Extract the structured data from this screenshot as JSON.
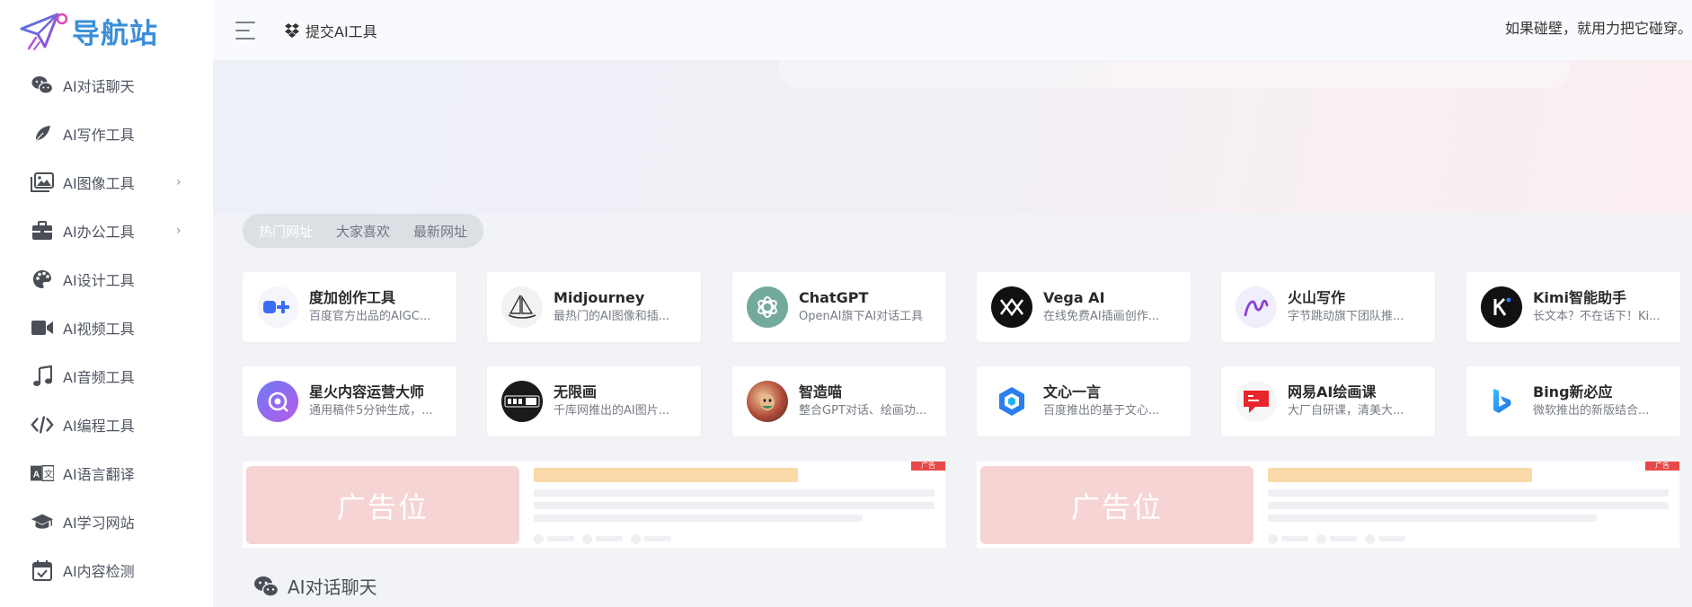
{
  "logo": {
    "text": "导航站"
  },
  "sidebar": {
    "items": [
      {
        "label": "AI对话聊天",
        "icon": "wechat-icon",
        "has_submenu": false
      },
      {
        "label": "AI写作工具",
        "icon": "feather-icon",
        "has_submenu": false
      },
      {
        "label": "AI图像工具",
        "icon": "images-icon",
        "has_submenu": true
      },
      {
        "label": "AI办公工具",
        "icon": "briefcase-icon",
        "has_submenu": true
      },
      {
        "label": "AI设计工具",
        "icon": "palette-icon",
        "has_submenu": false
      },
      {
        "label": "AI视频工具",
        "icon": "video-camera-icon",
        "has_submenu": false
      },
      {
        "label": "AI音频工具",
        "icon": "music-note-icon",
        "has_submenu": false
      },
      {
        "label": "AI编程工具",
        "icon": "code-icon",
        "has_submenu": false
      },
      {
        "label": "AI语言翻译",
        "icon": "translate-icon",
        "has_submenu": false
      },
      {
        "label": "AI学习网站",
        "icon": "graduation-cap-icon",
        "has_submenu": false
      },
      {
        "label": "AI内容检测",
        "icon": "calendar-check-icon",
        "has_submenu": false
      }
    ],
    "chevron": "›"
  },
  "topbar": {
    "submit_label": "提交AI工具",
    "slogan": "如果碰壁，就用力把它碰穿。"
  },
  "tabs": [
    {
      "label": "热门网址",
      "active": true
    },
    {
      "label": "大家喜欢",
      "active": false
    },
    {
      "label": "最新网址",
      "active": false
    }
  ],
  "cards": [
    {
      "title": "度加创作工具",
      "desc": "百度官方出品的AIGC...",
      "icon": "duja-icon"
    },
    {
      "title": "Midjourney",
      "desc": "最热门的AI图像和插...",
      "icon": "midjourney-sailboat-icon"
    },
    {
      "title": "ChatGPT",
      "desc": "OpenAI旗下AI对话工具",
      "icon": "openai-icon"
    },
    {
      "title": "Vega AI",
      "desc": "在线免费AI插画创作...",
      "icon": "vega-ai-icon"
    },
    {
      "title": "火山写作",
      "desc": "字节跳动旗下团队推...",
      "icon": "huoshan-writing-icon"
    },
    {
      "title": "Kimi智能助手",
      "desc": "长文本？不在话下！Ki...",
      "icon": "kimi-icon"
    },
    {
      "title": "星火内容运营大师",
      "desc": "通用稿件5分钟生成，...",
      "icon": "xinghuo-icon"
    },
    {
      "title": "无限画",
      "desc": "千库网推出的AI图片...",
      "icon": "wuxianhua-icon"
    },
    {
      "title": "智造喵",
      "desc": "整合GPT对话、绘画功...",
      "icon": "zhizaomiao-icon"
    },
    {
      "title": "文心一言",
      "desc": "百度推出的基于文心...",
      "icon": "wenxin-icon"
    },
    {
      "title": "网易AI绘画课",
      "desc": "大厂自研课，清美大...",
      "icon": "netease-ai-icon"
    },
    {
      "title": "Bing新必应",
      "desc": "微软推出的新版结合...",
      "icon": "bing-icon"
    }
  ],
  "ads": [
    {
      "placeholder": "广告位",
      "tag": "广告"
    },
    {
      "placeholder": "广告位",
      "tag": "广告"
    }
  ],
  "section": {
    "title": "AI对话聊天",
    "icon": "wechat-icon"
  },
  "colors": {
    "accent_blue": "#3b8ed8",
    "tab_bg": "#dcdfe4",
    "ad_pink": "#f7d4d4",
    "ad_tag_red": "#e84848"
  }
}
